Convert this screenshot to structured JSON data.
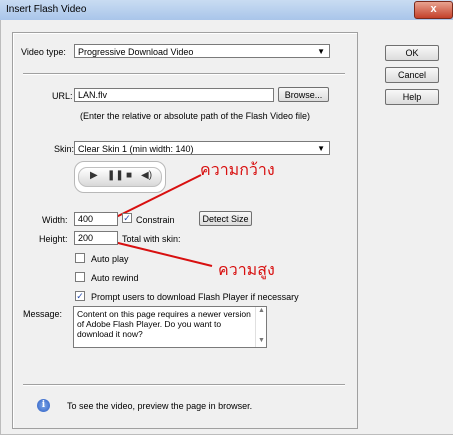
{
  "window": {
    "title": "Insert Flash Video",
    "close_glyph": "x"
  },
  "video_type": {
    "label": "Video type:",
    "value": "Progressive Download Video"
  },
  "url": {
    "label": "URL:",
    "value": "LAN.flv",
    "browse_label": "Browse...",
    "hint": "(Enter the relative or absolute path of the Flash Video file)"
  },
  "skin": {
    "label": "Skin:",
    "value": "Clear Skin 1 (min width: 140)"
  },
  "annotations": {
    "width_note": "ความกว้าง",
    "height_note": "ความสูง",
    "color": "#d81010"
  },
  "dimensions": {
    "width_label": "Width:",
    "width_value": "400",
    "constrain_label": "Constrain",
    "constrain_checked": true,
    "detect_size_label": "Detect Size",
    "height_label": "Height:",
    "height_value": "200",
    "total_with_skin_label": "Total with skin:"
  },
  "options": {
    "auto_play": {
      "label": "Auto play",
      "checked": false
    },
    "auto_rewind": {
      "label": "Auto rewind",
      "checked": false
    },
    "prompt": {
      "label": "Prompt users to download Flash Player if necessary",
      "checked": true
    }
  },
  "message": {
    "label": "Message:",
    "value": "Content on this page requires a newer version of Adobe Flash Player. Do you want to download it now?"
  },
  "side_buttons": {
    "ok": "OK",
    "cancel": "Cancel",
    "help": "Help"
  },
  "footer": {
    "info_glyph": "i",
    "note": "To see the video, preview the page in browser."
  }
}
